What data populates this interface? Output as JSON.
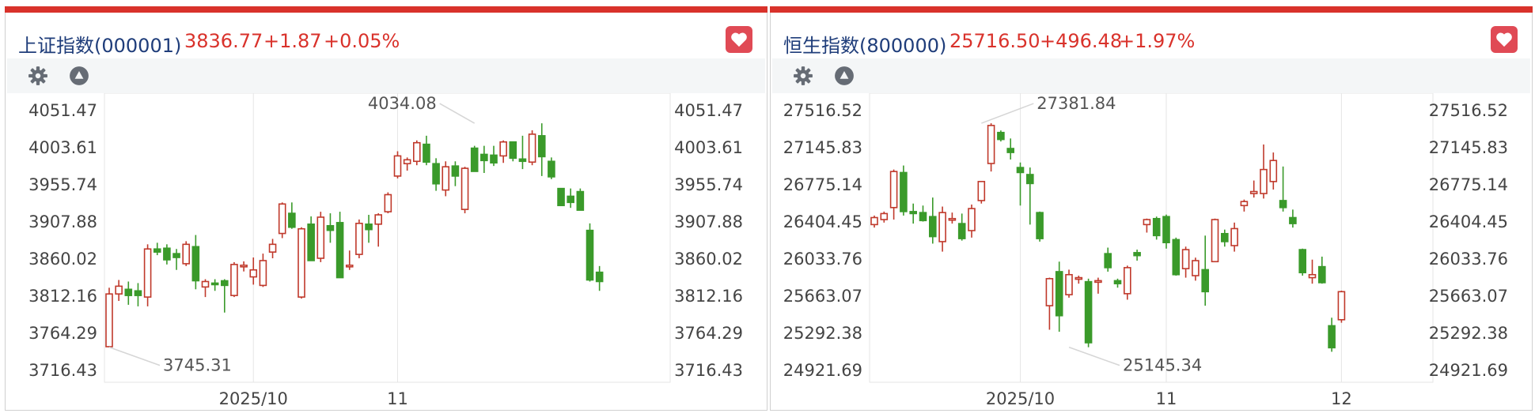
{
  "panels": [
    {
      "title": "上证指数(000001)",
      "price": "3836.77",
      "change": "+1.87",
      "change_pct": "+0.05%",
      "settings_icon": "gear-icon",
      "collapse_icon": "triangle-up-icon",
      "favorite_icon": "heart-icon"
    },
    {
      "title": "恒生指数(800000)",
      "price": "25716.50",
      "change": "+496.48",
      "change_pct": "+1.97%",
      "settings_icon": "gear-icon",
      "collapse_icon": "triangle-up-icon",
      "favorite_icon": "heart-icon"
    }
  ],
  "colors": {
    "accent": "#d9322b",
    "up": "#c0392b",
    "down": "#3a9a2a",
    "title": "#1f3d7a",
    "favorite": "#e04a55"
  },
  "chart_data": [
    {
      "type": "candlestick",
      "title": "上证指数(000001)",
      "ylim": [
        3716.43,
        4051.47
      ],
      "yticks": [
        "4051.47",
        "4003.61",
        "3955.74",
        "3907.88",
        "3860.02",
        "3812.16",
        "3764.29",
        "3716.43"
      ],
      "xtick_labels": [
        {
          "label": "2025/10",
          "index": 15
        },
        {
          "label": "11",
          "index": 30
        }
      ],
      "grid": true,
      "annotations": [
        {
          "text": "4034.08",
          "index": 38,
          "value": 4034.08,
          "side": "left-top"
        },
        {
          "text": "3745.31",
          "index": 0,
          "value": 3745.31,
          "side": "right-bottom"
        }
      ],
      "candles": [
        [
          3746,
          3822,
          3745.31,
          3814
        ],
        [
          3814,
          3832,
          3805,
          3824
        ],
        [
          3820,
          3830,
          3800,
          3812
        ],
        [
          3818,
          3828,
          3798,
          3812
        ],
        [
          3810,
          3878,
          3798,
          3872
        ],
        [
          3872,
          3880,
          3864,
          3868
        ],
        [
          3873,
          3878,
          3852,
          3858
        ],
        [
          3866,
          3872,
          3845,
          3861
        ],
        [
          3853,
          3882,
          3850,
          3878
        ],
        [
          3875,
          3890,
          3820,
          3831
        ],
        [
          3823,
          3833,
          3810,
          3830
        ],
        [
          3828,
          3833,
          3818,
          3826
        ],
        [
          3831,
          3833,
          3790,
          3825
        ],
        [
          3812,
          3855,
          3810,
          3852
        ],
        [
          3850,
          3856,
          3843,
          3851
        ],
        [
          3836,
          3861,
          3826,
          3845
        ],
        [
          3825,
          3866,
          3823,
          3857
        ],
        [
          3868,
          3885,
          3860,
          3878
        ],
        [
          3892,
          3932,
          3886,
          3930
        ],
        [
          3918,
          3932,
          3898,
          3900
        ],
        [
          3810,
          3900,
          3808,
          3898
        ],
        [
          3904,
          3914,
          3860,
          3857
        ],
        [
          3860,
          3920,
          3855,
          3913
        ],
        [
          3902,
          3918,
          3880,
          3896
        ],
        [
          3906,
          3920,
          3838,
          3835
        ],
        [
          3850,
          3870,
          3845,
          3851
        ],
        [
          3865,
          3910,
          3860,
          3905
        ],
        [
          3904,
          3916,
          3880,
          3897
        ],
        [
          3904,
          3918,
          3875,
          3916
        ],
        [
          3920,
          3945,
          3918,
          3942
        ],
        [
          3966,
          3998,
          3963,
          3992
        ],
        [
          3982,
          3990,
          3973,
          3987
        ],
        [
          3985,
          4012,
          3980,
          4009
        ],
        [
          4007,
          4018,
          3980,
          3984
        ],
        [
          3982,
          3989,
          3947,
          3956
        ],
        [
          3948,
          3985,
          3940,
          3978
        ],
        [
          3979,
          3985,
          3953,
          3966
        ],
        [
          3923,
          3978,
          3918,
          3976
        ],
        [
          4002,
          4005,
          3973,
          3972
        ],
        [
          3994,
          4005,
          3970,
          3986
        ],
        [
          3993,
          4005,
          3979,
          3983
        ],
        [
          3992,
          4012,
          3983,
          4010
        ],
        [
          4010,
          4010,
          3985,
          3989
        ],
        [
          3988,
          4018,
          3975,
          3985
        ],
        [
          3984,
          4025,
          3980,
          4020
        ],
        [
          4018,
          4034.08,
          3966,
          3991
        ],
        [
          3985,
          3990,
          3962,
          3965
        ],
        [
          3950,
          3950,
          3928,
          3928
        ],
        [
          3940,
          3950,
          3925,
          3932
        ],
        [
          3946,
          3950,
          3924,
          3922
        ],
        [
          3896,
          3905,
          3830,
          3832
        ],
        [
          3842,
          3850,
          3818,
          3830
        ]
      ]
    },
    {
      "type": "candlestick",
      "title": "恒生指数(800000)",
      "ylim": [
        24921.69,
        27516.52
      ],
      "yticks": [
        "27516.52",
        "27145.83",
        "26775.14",
        "26404.45",
        "26033.76",
        "25663.07",
        "25292.38",
        "24921.69"
      ],
      "xtick_labels": [
        {
          "label": "2025/10",
          "index": 15
        },
        {
          "label": "11",
          "index": 30
        },
        {
          "label": "12",
          "index": 48
        }
      ],
      "grid": true,
      "annotations": [
        {
          "text": "27381.84",
          "index": 11,
          "value": 27381.84,
          "side": "right-top"
        },
        {
          "text": "25145.34",
          "index": 20,
          "value": 25145.34,
          "side": "right-bottom"
        }
      ],
      "candles": [
        [
          26370,
          26460,
          26340,
          26440
        ],
        [
          26420,
          26500,
          26390,
          26480
        ],
        [
          26540,
          26920,
          26420,
          26900
        ],
        [
          26890,
          26960,
          26460,
          26500
        ],
        [
          26500,
          26580,
          26380,
          26480
        ],
        [
          26490,
          26560,
          26400,
          26410
        ],
        [
          26450,
          26640,
          26180,
          26250
        ],
        [
          26200,
          26550,
          26100,
          26490
        ],
        [
          26420,
          26490,
          26380,
          26430
        ],
        [
          26380,
          26480,
          26210,
          26230
        ],
        [
          26310,
          26570,
          26240,
          26530
        ],
        [
          26610,
          26800,
          26580,
          26800
        ],
        [
          26980,
          27381.84,
          26900,
          27360
        ],
        [
          27290,
          27310,
          27200,
          27220
        ],
        [
          27130,
          27230,
          27020,
          27090
        ],
        [
          26940,
          26990,
          26560,
          26890
        ],
        [
          26870,
          26940,
          26370,
          26780
        ],
        [
          26490,
          26500,
          26200,
          26230
        ],
        [
          25560,
          25840,
          25320,
          25830
        ],
        [
          25900,
          26000,
          25300,
          25460
        ],
        [
          25670,
          25920,
          25640,
          25870
        ],
        [
          25830,
          25860,
          25780,
          25840
        ],
        [
          25800,
          25830,
          25145.34,
          25190
        ],
        [
          25810,
          25840,
          25680,
          25810
        ],
        [
          26080,
          26140,
          25900,
          25940
        ],
        [
          25810,
          25830,
          25740,
          25780
        ],
        [
          25680,
          25960,
          25620,
          25940
        ],
        [
          26090,
          26120,
          26010,
          26060
        ],
        [
          26370,
          26430,
          26290,
          26420
        ],
        [
          26430,
          26450,
          26220,
          26260
        ],
        [
          26450,
          26470,
          26130,
          26190
        ],
        [
          26220,
          26240,
          25860,
          25870
        ],
        [
          25930,
          26150,
          25840,
          26120
        ],
        [
          25860,
          26040,
          25810,
          26010
        ],
        [
          25920,
          26260,
          25560,
          25700
        ],
        [
          26000,
          26430,
          26000,
          26420
        ],
        [
          26280,
          26320,
          26150,
          26200
        ],
        [
          26160,
          26390,
          26100,
          26330
        ],
        [
          26560,
          26620,
          26500,
          26600
        ],
        [
          26680,
          26810,
          26640,
          26700
        ],
        [
          26680,
          27170,
          26630,
          26920
        ],
        [
          26800,
          27090,
          26720,
          27010
        ],
        [
          26610,
          26950,
          26500,
          26540
        ],
        [
          26440,
          26520,
          26340,
          26380
        ],
        [
          26120,
          26130,
          25860,
          25890
        ],
        [
          25840,
          26020,
          25780,
          25870
        ],
        [
          25950,
          26050,
          25780,
          25790
        ],
        [
          25360,
          25440,
          25100,
          25140
        ],
        [
          25420,
          25710,
          25390,
          25700
        ]
      ]
    }
  ]
}
